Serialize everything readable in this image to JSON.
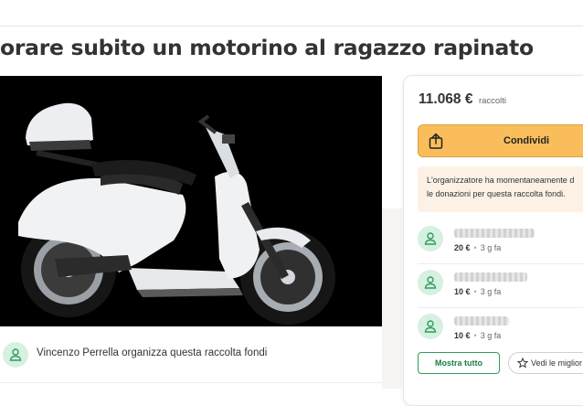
{
  "page": {
    "title": "orare subito un motorino al ragazzo rapinato",
    "hero_image": "scooter-photo"
  },
  "organizer": {
    "text": "Vincenzo Perrella organizza questa raccolta fondi",
    "icon": "user-icon"
  },
  "sidebar": {
    "amount": "11.068 €",
    "amount_label": "raccolti",
    "share_label": "Condividi",
    "share_icon": "share-icon",
    "notice_line1": "L'organizzatore ha momentaneamente d",
    "notice_line2": "le donazioni per questa raccolta fondi.",
    "donations": [
      {
        "amount": "20 €",
        "time": "3 g fa"
      },
      {
        "amount": "10 €",
        "time": "3 g fa"
      },
      {
        "amount": "10 €",
        "time": "3 g fa"
      }
    ],
    "show_all_label": "Mostra tutto",
    "top_label": "Vedi le miglior"
  },
  "colors": {
    "accent_green": "#2f9e5b",
    "share_yellow": "#f9be5b",
    "notice_bg": "#fdf1e6"
  }
}
